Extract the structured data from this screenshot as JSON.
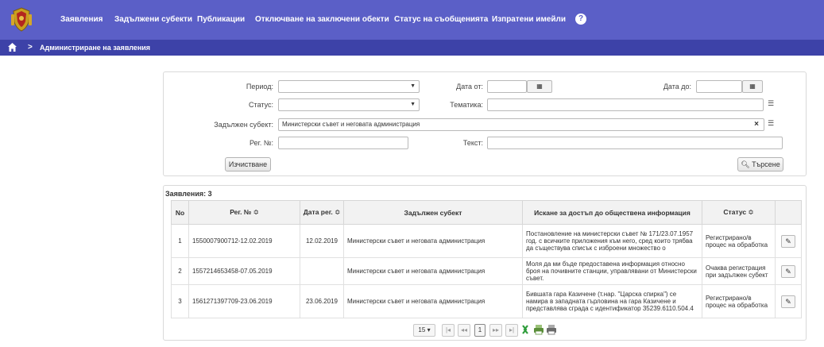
{
  "nav": {
    "items": [
      "Заявления",
      "Задължени субекти",
      "Публикации",
      "Отключване на заключени обекти",
      "Статус на съобщенията",
      "Изпратени имейли"
    ],
    "help_label": "?"
  },
  "breadcrumb": {
    "separator": ">",
    "current": "Администриране на заявления"
  },
  "search": {
    "period_label": "Период:",
    "period_value": "",
    "date_from_label": "Дата от:",
    "date_from_value": "",
    "date_to_label": "Дата до:",
    "date_to_value": "",
    "status_label": "Статус:",
    "status_value": "",
    "topic_label": "Тематика:",
    "topic_value": "",
    "subject_label": "Задължен субект:",
    "subject_value": "Министерски съвет и неговата администрация",
    "reg_no_label": "Рег. №:",
    "reg_no_value": "",
    "text_label": "Текст:",
    "text_value": "",
    "clear_button": "Изчистване",
    "search_button": "Търсене",
    "clear_x": "×"
  },
  "results": {
    "title": "Заявления: 3",
    "headers": [
      "No",
      "Рег. № ≎",
      "Дата рег. ≎",
      "Задължен субект",
      "Искане за достъп до обществена информация",
      "Статус ≎",
      ""
    ],
    "rows": [
      {
        "no": "1",
        "reg": "1550007900712-12.02.2019",
        "date": "12.02.2019",
        "subject": "Министерски съвет и неговата администрация",
        "request": "Постановление на министерски съвет № 171/23.07.1957 год. с всичките приложения към него, сред които трябва да съществува списък с изброени множество о",
        "status": "Регистрирано/в процес на обработка"
      },
      {
        "no": "2",
        "reg": "1557214653458-07.05.2019",
        "date": "",
        "subject": "Министерски съвет и неговата администрация",
        "request": "Моля да ми бъде предоставена информация относно броя на почивните станции, управлявани от Министерски съвет.",
        "status": "Очаква регистрация при задължен субект"
      },
      {
        "no": "3",
        "reg": "1561271397709-23.06.2019",
        "date": "23.06.2019",
        "subject": "Министерски съвет и неговата администрация",
        "request": "Бившата гара Казичене (т.нар. \"Царска спирка\") се намира в западната гърловина на гара Казичене и представлява сграда с идентификатор 35239.6110.504.4",
        "status": "Регистрирано/в процес на обработка"
      }
    ]
  },
  "pager": {
    "page_size": "15",
    "first": "|◂",
    "prev": "◂◂",
    "current_page": "1",
    "next": "▸▸",
    "last": "▸|"
  },
  "colors": {
    "nav_bg": "#5b5fc7",
    "crumb_bg": "#3d42a8",
    "excel_green": "#2e9d3a"
  }
}
